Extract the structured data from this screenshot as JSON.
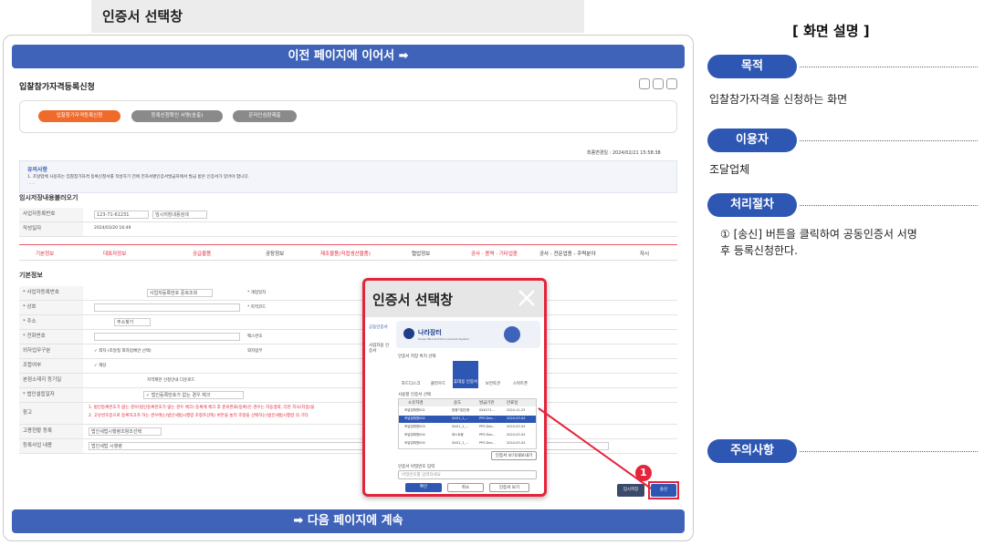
{
  "window": {
    "title": "인증서 선택창"
  },
  "bars": {
    "top": "이전 페이지에 이어서 ➡",
    "bottom": "➡ 다음 페이지에 계속"
  },
  "page": {
    "title": "입찰참가자격등록신청",
    "steps": [
      "입찰참가자격등록신청",
      "등록신청확인 서명(송출)",
      "온라인심판제출"
    ],
    "notice_title": "유의사항",
    "notice_text": "1. 조달업체 사용자는 입찰참가자격 등록신청서를 작성하기 전에 전자서명인증서발급자에서 발급 받은 인증서가 있어야 합니다.",
    "notice_more": "......",
    "last_modified": "최종변경일 : 2024/02/21 15:58:38",
    "temp_load_title": "임시저장내용불러오기",
    "biz_no_label": "사업자등록번호",
    "biz_no_value": "123-71-61231",
    "biz_no_btn": "임시저장내용검색",
    "date_label": "작성일자",
    "date_value": "2024/03/20 16:49",
    "tabs": [
      "기본정보",
      "대표자정보",
      "공급물품",
      "공장정보",
      "제조물품(직접생산물품)",
      "협업정보",
      "공사 · 용역 · 기타업종",
      "공사 : 전문업종 - 주력분야",
      "자시"
    ],
    "basic_title": "기본정보",
    "fields": [
      {
        "label": "* 사업자등록번호",
        "btn": "사업자등록번호 중복조회"
      },
      {
        "label": "* 상호",
        "btn": ""
      },
      {
        "label": "* 주소",
        "btn": "주소찾기"
      },
      {
        "label": "* 전화번호",
        "btn": ""
      },
      {
        "label": "외자업무구분",
        "btn": "✓ 외자   (조달청 외자업체만 선택)"
      },
      {
        "label": "조합여부",
        "btn": "✓ 해당"
      },
      {
        "label": "본점소재지 등기일",
        "btn": "지역제한 신청안내 다운로드"
      },
      {
        "label": "* 법인설립일자",
        "btn": "✓ 법인등록번호가 없는 경우 체크"
      },
      {
        "label": "참고",
        "btn": ""
      },
      {
        "label": "고용현황 등록",
        "btn": "법인세법시행령조항조선택"
      },
      {
        "label": "등록사업 내용",
        "btn": "법인세법 시행령"
      }
    ],
    "mid_labels": [
      "* 개업일자",
      "* 지역코드",
      "팩스번호",
      "외자업무"
    ],
    "warn_text_1": "1. 법인등록번호가 없는 경우(법인등록번호가 없는 경우 체크) 등록에 체크 후 준비완료(등록)인 경우는 자동생략, 다만 지사(지점)을",
    "warn_text_2": "2. 고유번호증으로 등록하고자 하는 경우에는(법인세법시행령 조항조선택) 버튼을 눌러 조항을 선택하는(법인세법시행령 의 기타",
    "btn_temp_save": "임시저장",
    "btn_send": "송신"
  },
  "popup": {
    "title": "인증서 선택창",
    "side_items": [
      "공동인증서",
      "사업자용 인증서"
    ],
    "logo": "나라장터",
    "logo_sub": "Korea ON-line E-Procurement System",
    "location_title": "인증서 저장 위치 선택",
    "locations": [
      "하드디스크",
      "클라우드",
      "휴대용 인증서",
      "보안토큰",
      "스마트폰"
    ],
    "cert_title": "사용할 인증서 선택",
    "columns": [
      "소유자명",
      "용도",
      "발급기관",
      "만료일"
    ],
    "rows": [
      [
        "조달업체명001",
        "범용기업인증",
        "SXX171...",
        "2024-11-23"
      ],
      [
        "조달업체명002",
        "SXX1_1_...",
        "PPS Dev...",
        "2024-03-04"
      ],
      [
        "조달업체명003",
        "SXX1_1_...",
        "PPS Dev...",
        "2024-03-04"
      ],
      [
        "조달업체명004",
        "테스트용",
        "PPS Dev...",
        "2024-03-04"
      ],
      [
        "조달업체명005",
        "SXX1_1_...",
        "PPS Dev...",
        "2024-03-04"
      ]
    ],
    "view_btn": "인증서 보기/내보내기",
    "pw_title": "인증서 비밀번호 입력",
    "pw_placeholder": "비밀번호를 입력하세요",
    "btn_ok": "확인",
    "btn_cancel": "취소",
    "btn_view": "인증서 보기"
  },
  "marker": "1",
  "right": {
    "heading": "[ 화면 설명 ]",
    "sections": [
      {
        "pill": "목적",
        "text": "입찰참가자격을 신청하는 화면"
      },
      {
        "pill": "이용자",
        "text": "조달업체"
      },
      {
        "pill": "처리절차",
        "text": "① [송신] 버튼을 클릭하여 공동인증서 서명\n    후 등록신청한다."
      },
      {
        "pill": "주의사항",
        "text": ""
      }
    ]
  },
  "colors": {
    "blue": "#3f63b8",
    "pill": "#2e57b4",
    "red": "#e5243b",
    "orange": "#f06a2b"
  }
}
